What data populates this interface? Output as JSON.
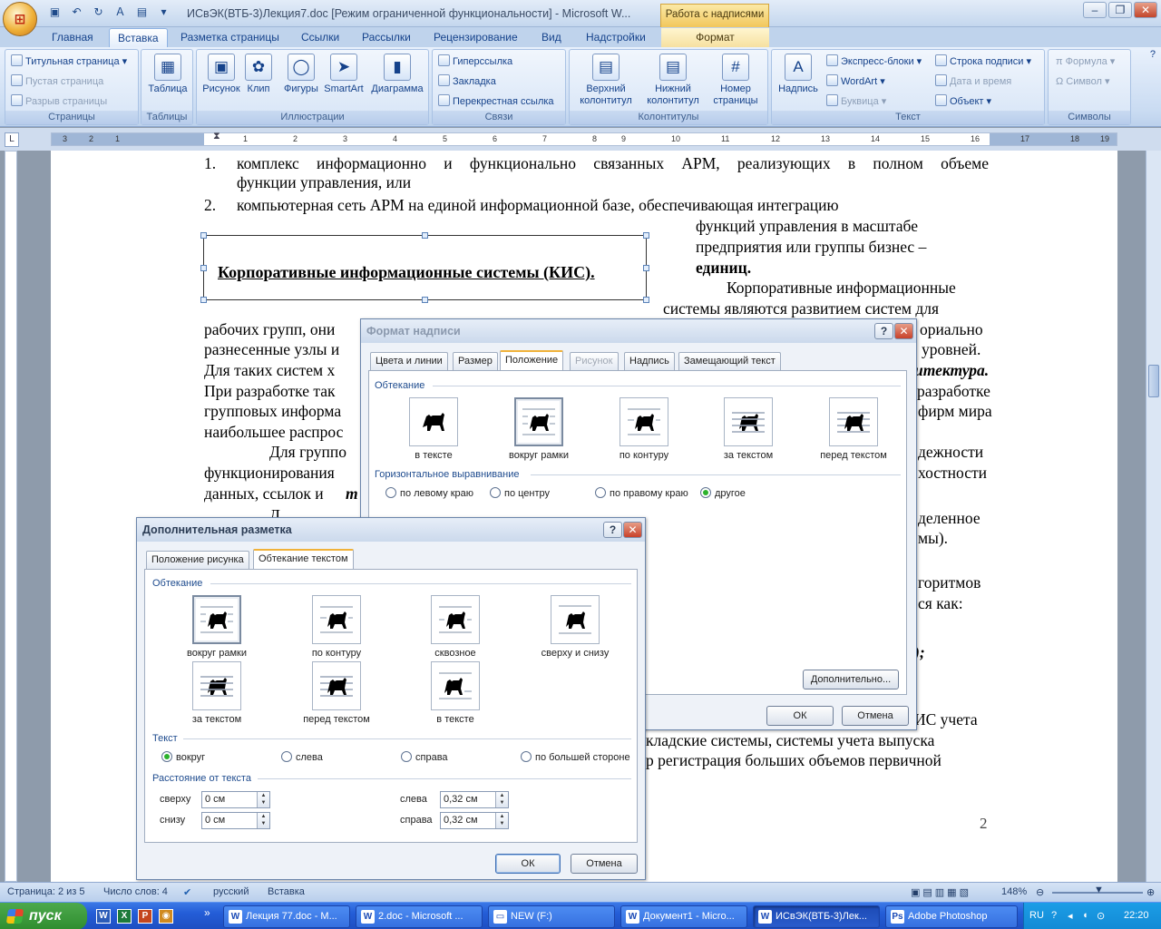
{
  "window": {
    "title": "ИСвЭК(ВТБ-3)Лекция7.doc [Режим ограниченной функциональности] - Microsoft W...",
    "tools_tab": "Работа с надписями"
  },
  "ribbon_tabs": [
    "Главная",
    "Вставка",
    "Разметка страницы",
    "Ссылки",
    "Рассылки",
    "Рецензирование",
    "Вид",
    "Надстройки",
    "Формат"
  ],
  "ribbon": {
    "pages": {
      "items": [
        "Титульная страница",
        "Пустая страница",
        "Разрыв страницы"
      ],
      "label": "Страницы"
    },
    "tables": {
      "button": "Таблица",
      "label": "Таблицы"
    },
    "illustrations": {
      "buttons": [
        "Рисунок",
        "Клип",
        "Фигуры",
        "SmartArt",
        "Диаграмма"
      ],
      "label": "Иллюстрации"
    },
    "links": {
      "items": [
        "Гиперссылка",
        "Закладка",
        "Перекрестная ссылка"
      ],
      "label": "Связи"
    },
    "headers": {
      "buttons": [
        "Верхний колонтитул",
        "Нижний колонтитул",
        "Номер страницы"
      ],
      "label": "Колонтитулы"
    },
    "text": {
      "big": "Надпись",
      "col1": [
        "Экспресс-блоки",
        "WordArt",
        "Буквица"
      ],
      "col2": [
        "Строка подписи",
        "Дата и время",
        "Объект"
      ],
      "label": "Текст"
    },
    "symbols": {
      "items": [
        "Формула",
        "Символ"
      ],
      "label": "Символы"
    }
  },
  "ruler": {
    "numbers": [
      "3",
      "2",
      "1",
      "1",
      "2",
      "3",
      "4",
      "5",
      "6",
      "7",
      "8",
      "9",
      "10",
      "11",
      "12",
      "13",
      "14",
      "15",
      "16",
      "17",
      "18",
      "19"
    ]
  },
  "document": {
    "list1_num": "1.",
    "list1_line1": "комплекс информационно и функционально связанных АРМ, реализующих в полном объеме",
    "list1_line2": "функции управления, или",
    "list2_num": "2.",
    "list2_line1": "компьютерная сеть АРМ на единой информационной базе, обеспечивающая   интеграцию",
    "wrap_lines": [
      "функций управления в масштабе",
      "предприятия или группы бизнес –",
      "единиц."
    ],
    "kis_title": "Корпоративные информационные системы (КИС).",
    "para_right1": "Корпоративные информационные",
    "para_right2": "системы являются развитием систем для",
    "left_fragments": [
      "рабочих групп, они",
      "разнесенные узлы и",
      "Для таких систем х",
      "При разработке так",
      "групповых информа",
      "наибольшее распрос"
    ],
    "right_fragments": [
      "ориально",
      "уровней.",
      "итектура.",
      "разработке",
      "фирм мира"
    ],
    "frag_group": "Для группо",
    "frag_func": "функционирования",
    "frag_data": "данных, ссылок и",
    "frag_bold": "т",
    "frag_d": "Д",
    "right2": [
      "дежности",
      "хостности"
    ],
    "right3": [
      "деленное",
      "мы)."
    ],
    "right4": [
      "горитмов",
      "ся как:"
    ],
    "right5": ");",
    "right6": "ИС   учета",
    "bottom1": "кладские системы, системы учета выпуска",
    "bottom2": "р регистрация больших объемов первичной",
    "page_number": "2"
  },
  "dialog_format": {
    "title": "Формат надписи",
    "tabs": [
      "Цвета и линии",
      "Размер",
      "Положение",
      "Рисунок",
      "Надпись",
      "Замещающий текст"
    ],
    "wrap_section": "Обтекание",
    "wrap_options": [
      "в тексте",
      "вокруг рамки",
      "по контуру",
      "за текстом",
      "перед текстом"
    ],
    "halign_section": "Горизонтальное выравнивание",
    "halign_options": [
      "по левому краю",
      "по центру",
      "по правому краю",
      "другое"
    ],
    "more_button": "Дополнительно...",
    "ok": "ОК",
    "cancel": "Отмена"
  },
  "dialog_layout": {
    "title": "Дополнительная разметка",
    "tabs": [
      "Положение рисунка",
      "Обтекание текстом"
    ],
    "wrap_section": "Обтекание",
    "wrap_options": [
      "вокруг рамки",
      "по контуру",
      "сквозное",
      "сверху и снизу",
      "за текстом",
      "перед текстом",
      "в тексте"
    ],
    "text_section": "Текст",
    "text_options": [
      "вокруг",
      "слева",
      "справа",
      "по большей стороне"
    ],
    "distance_section": "Расстояние от текста",
    "distance": {
      "top_label": "сверху",
      "top": "0 см",
      "bottom_label": "снизу",
      "bottom": "0 см",
      "left_label": "слева",
      "left": "0,32 см",
      "right_label": "справа",
      "right": "0,32 см"
    },
    "ok": "ОК",
    "cancel": "Отмена"
  },
  "statusbar": {
    "page": "Страница: 2 из 5",
    "words": "Число слов: 4",
    "lang": "русский",
    "mode": "Вставка",
    "zoom": "148%"
  },
  "taskbar": {
    "start": "пуск",
    "buttons": [
      "Лекция 77.doc - М...",
      "2.doc - Microsoft ...",
      "NEW (F:)",
      "Документ1 - Micro...",
      "ИСвЭК(ВТБ-3)Лек...",
      "Adobe Photoshop"
    ],
    "lang": "RU",
    "time": "22:20"
  }
}
